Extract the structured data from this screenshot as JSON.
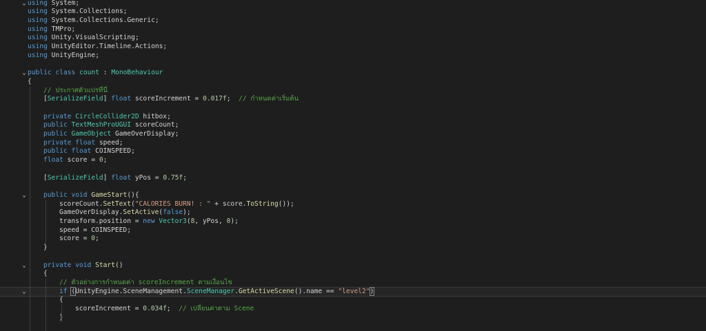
{
  "theme": {
    "background": "#1e1e1e",
    "keyword": "#569cd6",
    "type": "#4ec9b0",
    "method": "#dcdcaa",
    "comment": "#57a64a",
    "string": "#d69d85",
    "number": "#b5cea8",
    "text": "#d4d4d4"
  },
  "editor": {
    "lines": [
      {
        "indent": 0,
        "fold": "v",
        "tokens": [
          {
            "t": "using",
            "c": "kw"
          },
          {
            "t": " System;",
            "c": "plain"
          }
        ]
      },
      {
        "indent": 0,
        "tokens": [
          {
            "t": "using",
            "c": "kw"
          },
          {
            "t": " System.Collections;",
            "c": "plain"
          }
        ]
      },
      {
        "indent": 0,
        "tokens": [
          {
            "t": "using",
            "c": "kw"
          },
          {
            "t": " System.Collections.Generic;",
            "c": "plain"
          }
        ]
      },
      {
        "indent": 0,
        "tokens": [
          {
            "t": "using",
            "c": "kw"
          },
          {
            "t": " TMPro;",
            "c": "plain"
          }
        ]
      },
      {
        "indent": 0,
        "tokens": [
          {
            "t": "using",
            "c": "kw"
          },
          {
            "t": " Unity.VisualScripting;",
            "c": "plain"
          }
        ]
      },
      {
        "indent": 0,
        "tokens": [
          {
            "t": "using",
            "c": "kw"
          },
          {
            "t": " UnityEditor.Timeline.Actions;",
            "c": "plain"
          }
        ]
      },
      {
        "indent": 0,
        "tokens": [
          {
            "t": "using",
            "c": "kw"
          },
          {
            "t": " UnityEngine;",
            "c": "plain"
          }
        ]
      },
      {
        "indent": 0,
        "tokens": []
      },
      {
        "indent": 0,
        "fold": "v",
        "tokens": [
          {
            "t": "public",
            "c": "kw"
          },
          {
            "t": " ",
            "c": "plain"
          },
          {
            "t": "class",
            "c": "kw"
          },
          {
            "t": " ",
            "c": "plain"
          },
          {
            "t": "count",
            "c": "cls"
          },
          {
            "t": " : ",
            "c": "plain"
          },
          {
            "t": "MonoBehaviour",
            "c": "cls"
          }
        ]
      },
      {
        "indent": 0,
        "tokens": [
          {
            "t": "{",
            "c": "plain"
          }
        ]
      },
      {
        "indent": 1,
        "tokens": [
          {
            "t": "// ประกาศตัวแปรที่นี่",
            "c": "cmt"
          }
        ]
      },
      {
        "indent": 1,
        "tokens": [
          {
            "t": "[",
            "c": "plain"
          },
          {
            "t": "SerializeField",
            "c": "cls"
          },
          {
            "t": "] ",
            "c": "plain"
          },
          {
            "t": "float",
            "c": "kw"
          },
          {
            "t": " scoreIncrement = ",
            "c": "plain"
          },
          {
            "t": "0.017f",
            "c": "num"
          },
          {
            "t": ";  ",
            "c": "plain"
          },
          {
            "t": "// กำหนดค่าเริ่มต้น",
            "c": "cmt"
          }
        ]
      },
      {
        "indent": 1,
        "tokens": []
      },
      {
        "indent": 1,
        "tokens": [
          {
            "t": "private",
            "c": "kw"
          },
          {
            "t": " ",
            "c": "plain"
          },
          {
            "t": "CircleCollider2D",
            "c": "cls"
          },
          {
            "t": " hitbox;",
            "c": "plain"
          }
        ]
      },
      {
        "indent": 1,
        "tokens": [
          {
            "t": "public",
            "c": "kw"
          },
          {
            "t": " ",
            "c": "plain"
          },
          {
            "t": "TextMeshProUGUI",
            "c": "cls"
          },
          {
            "t": " scoreCount;",
            "c": "plain"
          }
        ]
      },
      {
        "indent": 1,
        "tokens": [
          {
            "t": "public",
            "c": "kw"
          },
          {
            "t": " ",
            "c": "plain"
          },
          {
            "t": "GameObject",
            "c": "cls"
          },
          {
            "t": " GameOverDisplay;",
            "c": "plain"
          }
        ]
      },
      {
        "indent": 1,
        "tokens": [
          {
            "t": "private",
            "c": "kw"
          },
          {
            "t": " ",
            "c": "plain"
          },
          {
            "t": "float",
            "c": "kw"
          },
          {
            "t": " speed;",
            "c": "plain"
          }
        ]
      },
      {
        "indent": 1,
        "tokens": [
          {
            "t": "public",
            "c": "kw"
          },
          {
            "t": " ",
            "c": "plain"
          },
          {
            "t": "float",
            "c": "kw"
          },
          {
            "t": " COINSPEED;",
            "c": "plain"
          }
        ]
      },
      {
        "indent": 1,
        "tokens": [
          {
            "t": "float",
            "c": "kw"
          },
          {
            "t": " score = ",
            "c": "plain"
          },
          {
            "t": "0",
            "c": "num"
          },
          {
            "t": ";",
            "c": "plain"
          }
        ]
      },
      {
        "indent": 1,
        "tokens": []
      },
      {
        "indent": 1,
        "tokens": [
          {
            "t": "[",
            "c": "plain"
          },
          {
            "t": "SerializeField",
            "c": "cls"
          },
          {
            "t": "] ",
            "c": "plain"
          },
          {
            "t": "float",
            "c": "kw"
          },
          {
            "t": " yPos = ",
            "c": "plain"
          },
          {
            "t": "0.75f",
            "c": "num"
          },
          {
            "t": ";",
            "c": "plain"
          }
        ]
      },
      {
        "indent": 1,
        "tokens": []
      },
      {
        "indent": 1,
        "fold": "v",
        "tokens": [
          {
            "t": "public",
            "c": "kw"
          },
          {
            "t": " ",
            "c": "plain"
          },
          {
            "t": "void",
            "c": "kw"
          },
          {
            "t": " ",
            "c": "plain"
          },
          {
            "t": "GameStart",
            "c": "fn"
          },
          {
            "t": "(){",
            "c": "plain"
          }
        ]
      },
      {
        "indent": 2,
        "tokens": [
          {
            "t": "scoreCount.",
            "c": "plain"
          },
          {
            "t": "SetText",
            "c": "fn"
          },
          {
            "t": "(",
            "c": "plain"
          },
          {
            "t": "\"CALORIES BURN! : \"",
            "c": "str"
          },
          {
            "t": " + score.",
            "c": "plain"
          },
          {
            "t": "ToString",
            "c": "fn"
          },
          {
            "t": "());",
            "c": "plain"
          }
        ]
      },
      {
        "indent": 2,
        "tokens": [
          {
            "t": "GameOverDisplay.",
            "c": "plain"
          },
          {
            "t": "SetActive",
            "c": "fn"
          },
          {
            "t": "(",
            "c": "plain"
          },
          {
            "t": "false",
            "c": "kw"
          },
          {
            "t": ");",
            "c": "plain"
          }
        ]
      },
      {
        "indent": 2,
        "tokens": [
          {
            "t": "transform.position = ",
            "c": "plain"
          },
          {
            "t": "new",
            "c": "kw"
          },
          {
            "t": " ",
            "c": "plain"
          },
          {
            "t": "Vector3",
            "c": "cls"
          },
          {
            "t": "(",
            "c": "plain"
          },
          {
            "t": "8",
            "c": "num"
          },
          {
            "t": ", yPos, ",
            "c": "plain"
          },
          {
            "t": "0",
            "c": "num"
          },
          {
            "t": ");",
            "c": "plain"
          }
        ]
      },
      {
        "indent": 2,
        "tokens": [
          {
            "t": "speed = COINSPEED;",
            "c": "plain"
          }
        ]
      },
      {
        "indent": 2,
        "tokens": [
          {
            "t": "score = ",
            "c": "plain"
          },
          {
            "t": "0",
            "c": "num"
          },
          {
            "t": ";",
            "c": "plain"
          }
        ]
      },
      {
        "indent": 1,
        "tokens": [
          {
            "t": "}",
            "c": "plain"
          }
        ]
      },
      {
        "indent": 1,
        "tokens": []
      },
      {
        "indent": 1,
        "fold": "v",
        "tokens": [
          {
            "t": "private",
            "c": "kw"
          },
          {
            "t": " ",
            "c": "plain"
          },
          {
            "t": "void",
            "c": "kw"
          },
          {
            "t": " ",
            "c": "plain"
          },
          {
            "t": "Start",
            "c": "fn"
          },
          {
            "t": "()",
            "c": "plain"
          }
        ]
      },
      {
        "indent": 1,
        "tokens": [
          {
            "t": "{",
            "c": "plain"
          }
        ]
      },
      {
        "indent": 2,
        "tokens": [
          {
            "t": "// ตัวอย่างการกำหนดค่า scoreIncrement ตามเงื่อนไข",
            "c": "cmt"
          }
        ]
      },
      {
        "indent": 2,
        "fold": "v",
        "current": true,
        "tokens": [
          {
            "t": "if",
            "c": "kw"
          },
          {
            "t": " ",
            "c": "plain"
          },
          {
            "t": "(",
            "c": "plain",
            "hl": true
          },
          {
            "t": "UnityEngine.SceneManagement.",
            "c": "plain"
          },
          {
            "t": "SceneManager",
            "c": "cls"
          },
          {
            "t": ".",
            "c": "plain"
          },
          {
            "t": "GetActiveScene",
            "c": "fn"
          },
          {
            "t": "().name == ",
            "c": "plain"
          },
          {
            "t": "\"level2\"",
            "c": "str"
          },
          {
            "t": ")",
            "c": "plain",
            "hl": true
          }
        ]
      },
      {
        "indent": 2,
        "tokens": [
          {
            "t": "{",
            "c": "plain"
          }
        ]
      },
      {
        "indent": 3,
        "tokens": [
          {
            "t": "scoreIncrement = ",
            "c": "plain"
          },
          {
            "t": "0.034f",
            "c": "num"
          },
          {
            "t": ";  ",
            "c": "plain"
          },
          {
            "t": "// เปลี่ยนค่าตาม Scene",
            "c": "cmt"
          }
        ]
      },
      {
        "indent": 2,
        "tokens": [
          {
            "t": "}",
            "c": "plain"
          }
        ]
      },
      {
        "indent": 2,
        "tokens": []
      }
    ]
  }
}
